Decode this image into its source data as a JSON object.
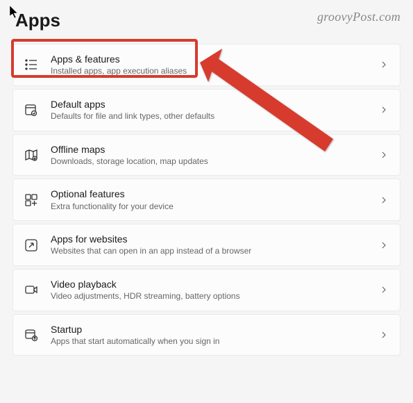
{
  "page_title": "Apps",
  "watermark": "groovyPost.com",
  "items": [
    {
      "id": "apps-features",
      "title": "Apps & features",
      "subtitle": "Installed apps, app execution aliases",
      "icon": "apps-features-icon"
    },
    {
      "id": "default-apps",
      "title": "Default apps",
      "subtitle": "Defaults for file and link types, other defaults",
      "icon": "default-apps-icon"
    },
    {
      "id": "offline-maps",
      "title": "Offline maps",
      "subtitle": "Downloads, storage location, map updates",
      "icon": "offline-maps-icon"
    },
    {
      "id": "optional-features",
      "title": "Optional features",
      "subtitle": "Extra functionality for your device",
      "icon": "optional-features-icon"
    },
    {
      "id": "apps-websites",
      "title": "Apps for websites",
      "subtitle": "Websites that can open in an app instead of a browser",
      "icon": "apps-websites-icon"
    },
    {
      "id": "video-playback",
      "title": "Video playback",
      "subtitle": "Video adjustments, HDR streaming, battery options",
      "icon": "video-playback-icon"
    },
    {
      "id": "startup",
      "title": "Startup",
      "subtitle": "Apps that start automatically when you sign in",
      "icon": "startup-icon"
    }
  ],
  "annotation": {
    "highlight_item": "apps-features",
    "arrow_color": "#d73a2e"
  }
}
